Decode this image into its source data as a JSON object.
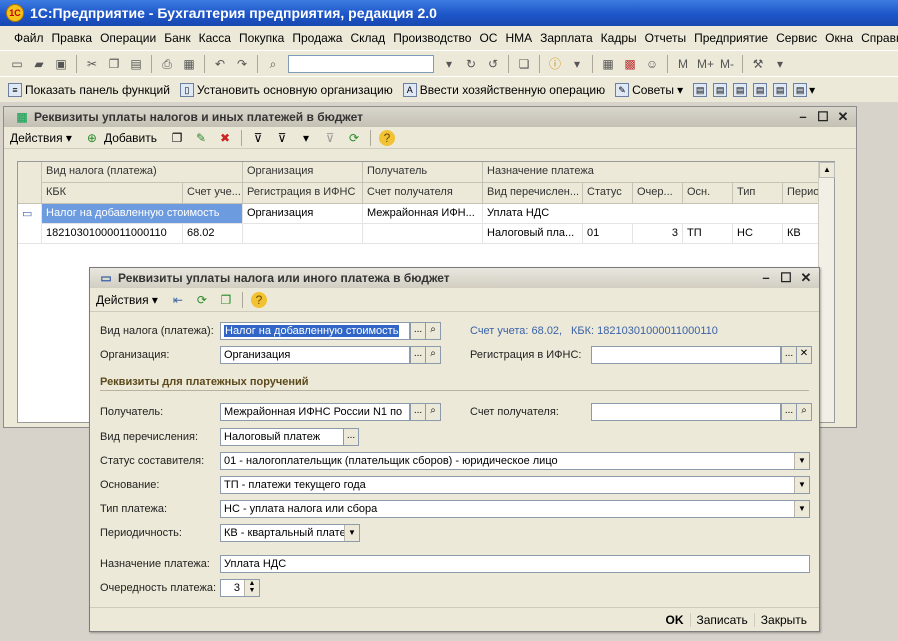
{
  "app": {
    "title": "1С:Предприятие - Бухгалтерия предприятия, редакция 2.0",
    "logo": "1С"
  },
  "menu": [
    "Файл",
    "Правка",
    "Операции",
    "Банк",
    "Касса",
    "Покупка",
    "Продажа",
    "Склад",
    "Производство",
    "ОС",
    "НМА",
    "Зарплата",
    "Кадры",
    "Отчеты",
    "Предприятие",
    "Сервис",
    "Окна",
    "Справка"
  ],
  "toolbar2": {
    "show_panel": "Показать панель функций",
    "set_org": "Установить основную организацию",
    "enter_op": "Ввести хозяйственную операцию",
    "tips": "Советы"
  },
  "list_window": {
    "title": "Реквизиты уплаты налогов и иных платежей в бюджет",
    "actions_label": "Действия",
    "add_label": "Добавить",
    "headers_row1": [
      "Вид налога (платежа)",
      "Организация",
      "Получатель",
      "Назначение платежа"
    ],
    "headers_row2": [
      "КБК",
      "Счет уче...",
      "Регистрация в ИФНС",
      "Счет получателя",
      "Вид перечислен...",
      "Статус",
      "Очер...",
      "Осн.",
      "Тип",
      "Перио..."
    ],
    "row1": {
      "tax_type": "Налог на добавленную стоимость",
      "org": "Организация",
      "recipient": "Межрайонная ИФН...",
      "purpose": "Уплата НДС"
    },
    "row2": {
      "kbk": "18210301000011000110",
      "account": "68.02",
      "reg": "",
      "recipient_acc": "",
      "transfer": "Налоговый пла...",
      "status": "01",
      "order": "3",
      "basis": "ТП",
      "type": "НС",
      "period": "КВ"
    }
  },
  "dialog": {
    "title": "Реквизиты уплаты налога или иного платежа в бюджет",
    "actions_label": "Действия",
    "labels": {
      "tax_type": "Вид налога (платежа):",
      "org": "Организация:",
      "reg": "Регистрация в ИФНС:",
      "section": "Реквизиты для платежных поручений",
      "recipient": "Получатель:",
      "recipient_acc": "Счет получателя:",
      "transfer": "Вид перечисления:",
      "status": "Статус составителя:",
      "basis": "Основание:",
      "pay_type": "Тип платежа:",
      "period": "Периодичность:",
      "purpose": "Назначение платежа:",
      "order": "Очередность платежа:"
    },
    "values": {
      "tax_type": "Налог на добавленную стоимость",
      "org": "Организация",
      "reg": "",
      "recipient": "Межрайонная ИФНС России N1 по",
      "recipient_acc": "",
      "transfer": "Налоговый платеж",
      "status": "01 - налогоплательщик (плательщик сборов) - юридическое лицо",
      "basis": "ТП - платежи текущего года",
      "pay_type": "НС - уплата налога или сбора",
      "period": "КВ - квартальный платеж",
      "purpose": "Уплата НДС",
      "order": "3"
    },
    "hint_account": "Счет учета: 68.02,",
    "hint_kbk": "КБК: 18210301000011000110",
    "footer": {
      "ok": "OK",
      "save": "Записать",
      "close": "Закрыть"
    }
  },
  "colors": {
    "selection": "#6d9be0",
    "title_blue": "#1d56c9",
    "hint": "#3a62a8"
  }
}
